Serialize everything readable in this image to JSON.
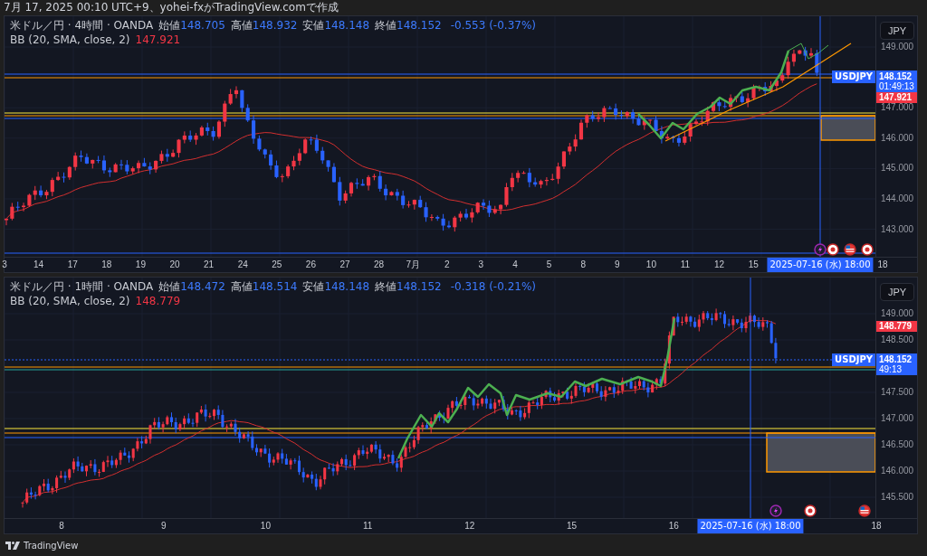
{
  "header": {
    "caption": "7月 17, 2025 00:10 UTC+9、yohei-fxがTradingView.comで作成"
  },
  "panels": [
    {
      "legend": {
        "title": "米ドル／円 · 4時間 · OANDA",
        "fields": [
          {
            "label": "始値",
            "value": "148.705"
          },
          {
            "label": "高値",
            "value": "148.932"
          },
          {
            "label": "安値",
            "value": "148.148"
          },
          {
            "label": "終値",
            "value": "148.152"
          }
        ],
        "change": "-0.553 (-0.37%)"
      },
      "indicator": {
        "name": "BB (20, SMA, close, 2)",
        "value": "147.921"
      },
      "currency": "JPY",
      "price_ticks": [
        "149.000",
        "147.000",
        "146.000",
        "145.000",
        "144.000",
        "143.000"
      ],
      "symbol_tag": "USDJPY",
      "last_price": "148.152",
      "countdown": "01:49:13",
      "indicator_tag": "147.921",
      "time_labels": [
        "3",
        "14",
        "17",
        "18",
        "19",
        "20",
        "21",
        "24",
        "25",
        "26",
        "27",
        "28",
        "7月",
        "2",
        "3",
        "4",
        "5",
        "8",
        "9",
        "10",
        "11",
        "12",
        "15"
      ],
      "crosshair_label": "2025-07-16 (水)   18:00",
      "time_labels_after": [
        "18"
      ]
    },
    {
      "legend": {
        "title": "米ドル／円 · 1時間 · OANDA",
        "fields": [
          {
            "label": "始値",
            "value": "148.472"
          },
          {
            "label": "高値",
            "value": "148.514"
          },
          {
            "label": "安値",
            "value": "148.148"
          },
          {
            "label": "終値",
            "value": "148.152"
          }
        ],
        "change": "-0.318 (-0.21%)"
      },
      "indicator": {
        "name": "BB (20, SMA, close, 2)",
        "value": "148.779"
      },
      "currency": "JPY",
      "price_ticks": [
        "149.000",
        "148.500",
        "147.500",
        "147.000",
        "146.500",
        "146.000",
        "145.500"
      ],
      "symbol_tag": "USDJPY",
      "last_price": "148.152",
      "countdown": "49:13",
      "indicator_tag": "148.779",
      "time_labels": [
        "8",
        "9",
        "10",
        "11",
        "12",
        "15",
        "16"
      ],
      "crosshair_label": "2025-07-16 (水)   18:00",
      "time_labels_after": [
        "18"
      ]
    }
  ],
  "footer": {
    "brand": "TradingView"
  }
}
